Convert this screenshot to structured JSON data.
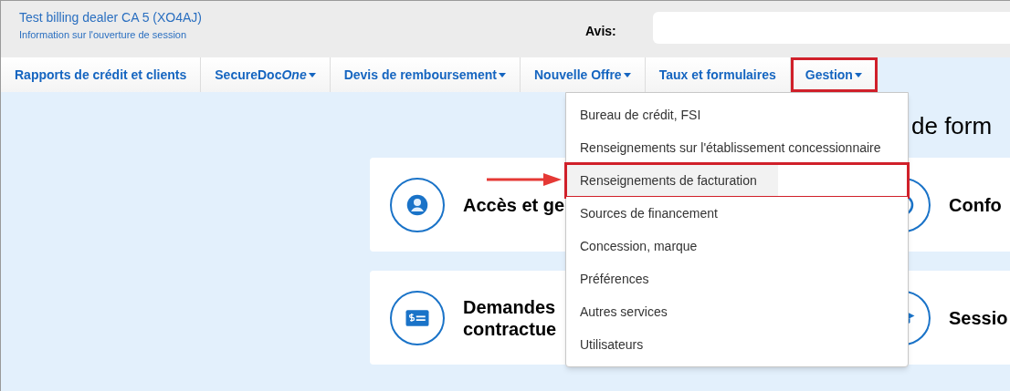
{
  "header": {
    "account_name": "Test billing dealer CA 5 (XO4AJ)",
    "session_link": "Information sur l'ouverture de session",
    "notice_label": "Avis:"
  },
  "tabs": [
    {
      "label": "Rapports de crédit et clients",
      "has_menu": false,
      "selected": false
    },
    {
      "label": "SecureDoc",
      "label_italic": "One",
      "has_menu": true,
      "selected": false
    },
    {
      "label": "Devis de remboursement",
      "has_menu": true,
      "selected": false
    },
    {
      "label": "Nouvelle Offre",
      "has_menu": true,
      "selected": false
    },
    {
      "label": "Taux et formulaires",
      "has_menu": false,
      "selected": false
    },
    {
      "label": "Gestion",
      "has_menu": true,
      "selected": true
    }
  ],
  "dropdown": {
    "items": [
      {
        "label": "Bureau de crédit, FSI",
        "selected": false
      },
      {
        "label": "Renseignements sur l'établissement concessionnaire",
        "selected": false
      },
      {
        "label": "Renseignements de facturation",
        "selected": true
      },
      {
        "label": "Sources de financement",
        "selected": false
      },
      {
        "label": "Concession, marque",
        "selected": false
      },
      {
        "label": "Préférences",
        "selected": false
      },
      {
        "label": "Autres services",
        "selected": false
      },
      {
        "label": "Utilisateurs",
        "selected": false
      }
    ]
  },
  "content": {
    "heading": "de form",
    "cards": [
      {
        "kind": "user",
        "title": "Accès et ge"
      },
      {
        "kind": "check",
        "title": "Confo"
      },
      {
        "kind": "money",
        "title": "Demandes contractue"
      },
      {
        "kind": "cap",
        "title": "Sessio"
      }
    ]
  }
}
